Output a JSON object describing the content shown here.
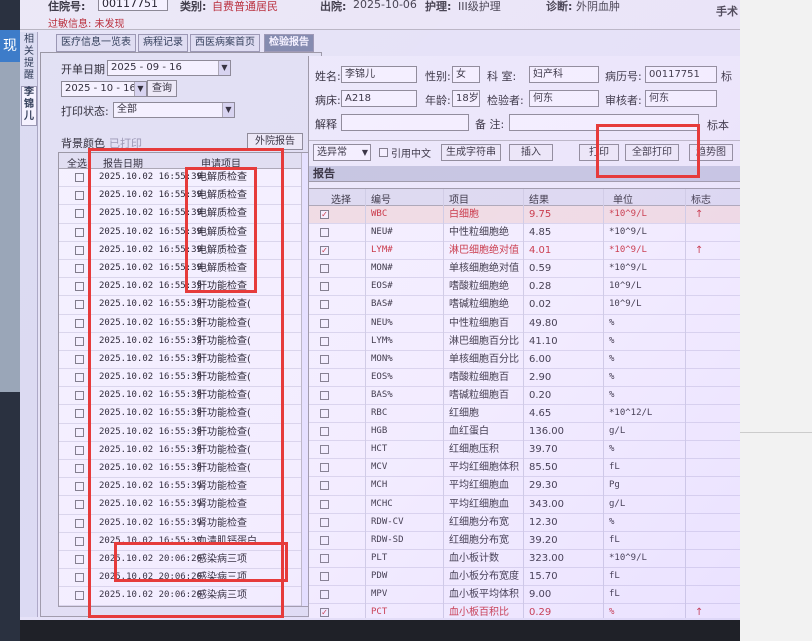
{
  "patient": {
    "inpatient_no_label": "住院号:",
    "inpatient_no": "00117751",
    "category_label": "类别:",
    "category": "自费普通居民",
    "discharge_label": "出院:",
    "discharge_date": "2025-10-06",
    "nursing_label": "护理:",
    "nursing": "III级护理",
    "diagnosis_label": "诊断:",
    "diagnosis": "外阴血肿",
    "extra": "手术",
    "allergy": "过敏信息: 未发现"
  },
  "side_tabs": [
    "相关提醒",
    "李锦儿"
  ],
  "tabs": [
    "医疗信息一览表",
    "病程记录",
    "西医病案首页",
    "检验报告"
  ],
  "left_panel": {
    "start_date_label": "开单日期",
    "start_date": "2025 - 09 - 16",
    "end_date": "2025 - 10 - 16",
    "query_button": "查询",
    "print_status_label": "打印状态:",
    "print_status": "全部",
    "bg_color_label": "背景颜色",
    "printed_label": "已打印",
    "external_report_button": "外院报告",
    "columns": [
      "全选",
      "报告日期",
      "申请项目"
    ],
    "rows": [
      {
        "date": "2025.10.02 16:55:39",
        "item": "电解质检查"
      },
      {
        "date": "2025.10.02 16:55:39",
        "item": "电解质检查"
      },
      {
        "date": "2025.10.02 16:55:39",
        "item": "电解质检查"
      },
      {
        "date": "2025.10.02 16:55:39",
        "item": "电解质检查"
      },
      {
        "date": "2025.10.02 16:55:39",
        "item": "电解质检查"
      },
      {
        "date": "2025.10.02 16:55:39",
        "item": "电解质检查"
      },
      {
        "date": "2025.10.02 16:55:39",
        "item": "肝功能检查"
      },
      {
        "date": "2025.10.02 16:55:39",
        "item": "肝功能检查("
      },
      {
        "date": "2025.10.02 16:55:39",
        "item": "肝功能检查("
      },
      {
        "date": "2025.10.02 16:55:39",
        "item": "肝功能检查("
      },
      {
        "date": "2025.10.02 16:55:39",
        "item": "肝功能检查("
      },
      {
        "date": "2025.10.02 16:55:39",
        "item": "肝功能检查("
      },
      {
        "date": "2025.10.02 16:55:39",
        "item": "肝功能检查("
      },
      {
        "date": "2025.10.02 16:55:39",
        "item": "肝功能检查("
      },
      {
        "date": "2025.10.02 16:55:39",
        "item": "肝功能检查("
      },
      {
        "date": "2025.10.02 16:55:39",
        "item": "肝功能检查("
      },
      {
        "date": "2025.10.02 16:55:39",
        "item": "肝功能检查("
      },
      {
        "date": "2025.10.02 16:55:39",
        "item": "肾功能检查"
      },
      {
        "date": "2025.10.02 16:55:39",
        "item": "肾功能检查"
      },
      {
        "date": "2025.10.02 16:55:39",
        "item": "肾功能检查"
      },
      {
        "date": "2025.10.02 16:55:39",
        "item": "血清肌钙蛋白"
      },
      {
        "date": "2025.10.02 20:06:20",
        "item": "感染病三项"
      },
      {
        "date": "2025.10.02 20:06:20",
        "item": "感染病三项"
      },
      {
        "date": "2025.10.02 20:06:20",
        "item": "感染病三项"
      }
    ]
  },
  "right_panel": {
    "name_label": "姓名:",
    "name": "李锦儿",
    "gender_label": "性别:",
    "gender": "女",
    "dept_label": "科 室:",
    "dept": "妇产科",
    "record_no_label": "病历号:",
    "record_no": "00117751",
    "bed_label": "病床:",
    "bed": "A218",
    "age_label": "年龄:",
    "age": "18岁",
    "tester_label": "检验者:",
    "tester": "何东",
    "reviewer_label": "审核者:",
    "reviewer": "何东",
    "explain_label": "解释",
    "note_label": "备 注:",
    "specimen_label": "标本",
    "status_combo": "选异常",
    "quote_cn": "引用中文",
    "gen_string_button": "生成字符串",
    "insert_button": "插入",
    "print_button": "打印",
    "print_all_button": "全部打印",
    "trend_button": "趋势图",
    "report_title": "报告",
    "columns": [
      "选择",
      "编号",
      "项目",
      "结果",
      "单位",
      "标志"
    ],
    "rows": [
      {
        "checked": true,
        "code": "WBC",
        "name": "白细胞",
        "result": "9.75",
        "unit": "*10^9/L",
        "flag": "↑",
        "abnormal": true,
        "highlight": true
      },
      {
        "checked": false,
        "code": "NEU#",
        "name": "中性粒细胞绝",
        "result": "4.85",
        "unit": "*10^9/L",
        "flag": "",
        "abnormal": false
      },
      {
        "checked": true,
        "code": "LYM#",
        "name": "淋巴细胞绝对值",
        "result": "4.01",
        "unit": "*10^9/L",
        "flag": "↑",
        "abnormal": true
      },
      {
        "checked": false,
        "code": "MON#",
        "name": "单核细胞绝对值",
        "result": "0.59",
        "unit": "*10^9/L",
        "flag": "",
        "abnormal": false
      },
      {
        "checked": false,
        "code": "EOS#",
        "name": "嗜酸粒细胞绝",
        "result": "0.28",
        "unit": "10^9/L",
        "flag": "",
        "abnormal": false
      },
      {
        "checked": false,
        "code": "BAS#",
        "name": "嗜碱粒细胞绝",
        "result": "0.02",
        "unit": "10^9/L",
        "flag": "",
        "abnormal": false
      },
      {
        "checked": false,
        "code": "NEU%",
        "name": "中性粒细胞百",
        "result": "49.80",
        "unit": "%",
        "flag": "",
        "abnormal": false
      },
      {
        "checked": false,
        "code": "LYM%",
        "name": "淋巴细胞百分比",
        "result": "41.10",
        "unit": "%",
        "flag": "",
        "abnormal": false
      },
      {
        "checked": false,
        "code": "MON%",
        "name": "单核细胞百分比",
        "result": "6.00",
        "unit": "%",
        "flag": "",
        "abnormal": false
      },
      {
        "checked": false,
        "code": "EOS%",
        "name": "嗜酸粒细胞百",
        "result": "2.90",
        "unit": "%",
        "flag": "",
        "abnormal": false
      },
      {
        "checked": false,
        "code": "BAS%",
        "name": "嗜碱粒细胞百",
        "result": "0.20",
        "unit": "%",
        "flag": "",
        "abnormal": false
      },
      {
        "checked": false,
        "code": "RBC",
        "name": "红细胞",
        "result": "4.65",
        "unit": "*10^12/L",
        "flag": "",
        "abnormal": false
      },
      {
        "checked": false,
        "code": "HGB",
        "name": "血红蛋白",
        "result": "136.00",
        "unit": "g/L",
        "flag": "",
        "abnormal": false
      },
      {
        "checked": false,
        "code": "HCT",
        "name": "红细胞压积",
        "result": "39.70",
        "unit": "%",
        "flag": "",
        "abnormal": false
      },
      {
        "checked": false,
        "code": "MCV",
        "name": "平均红细胞体积",
        "result": "85.50",
        "unit": "fL",
        "flag": "",
        "abnormal": false
      },
      {
        "checked": false,
        "code": "MCH",
        "name": "平均红细胞血",
        "result": "29.30",
        "unit": "Pg",
        "flag": "",
        "abnormal": false
      },
      {
        "checked": false,
        "code": "MCHC",
        "name": "平均红细胞血",
        "result": "343.00",
        "unit": "g/L",
        "flag": "",
        "abnormal": false
      },
      {
        "checked": false,
        "code": "RDW-CV",
        "name": "红细胞分布宽",
        "result": "12.30",
        "unit": "%",
        "flag": "",
        "abnormal": false
      },
      {
        "checked": false,
        "code": "RDW-SD",
        "name": "红细胞分布宽",
        "result": "39.20",
        "unit": "fL",
        "flag": "",
        "abnormal": false
      },
      {
        "checked": false,
        "code": "PLT",
        "name": "血小板计数",
        "result": "323.00",
        "unit": "*10^9/L",
        "flag": "",
        "abnormal": false
      },
      {
        "checked": false,
        "code": "PDW",
        "name": "血小板分布宽度",
        "result": "15.70",
        "unit": "fL",
        "flag": "",
        "abnormal": false
      },
      {
        "checked": false,
        "code": "MPV",
        "name": "血小板平均体积",
        "result": "9.00",
        "unit": "fL",
        "flag": "",
        "abnormal": false
      },
      {
        "checked": true,
        "code": "PCT",
        "name": "血小板百积比",
        "result": "0.29",
        "unit": "%",
        "flag": "↑",
        "abnormal": true
      }
    ]
  },
  "colors": {
    "highlight_box": "#e63b3b",
    "abnormal_text": "#cc2222"
  }
}
